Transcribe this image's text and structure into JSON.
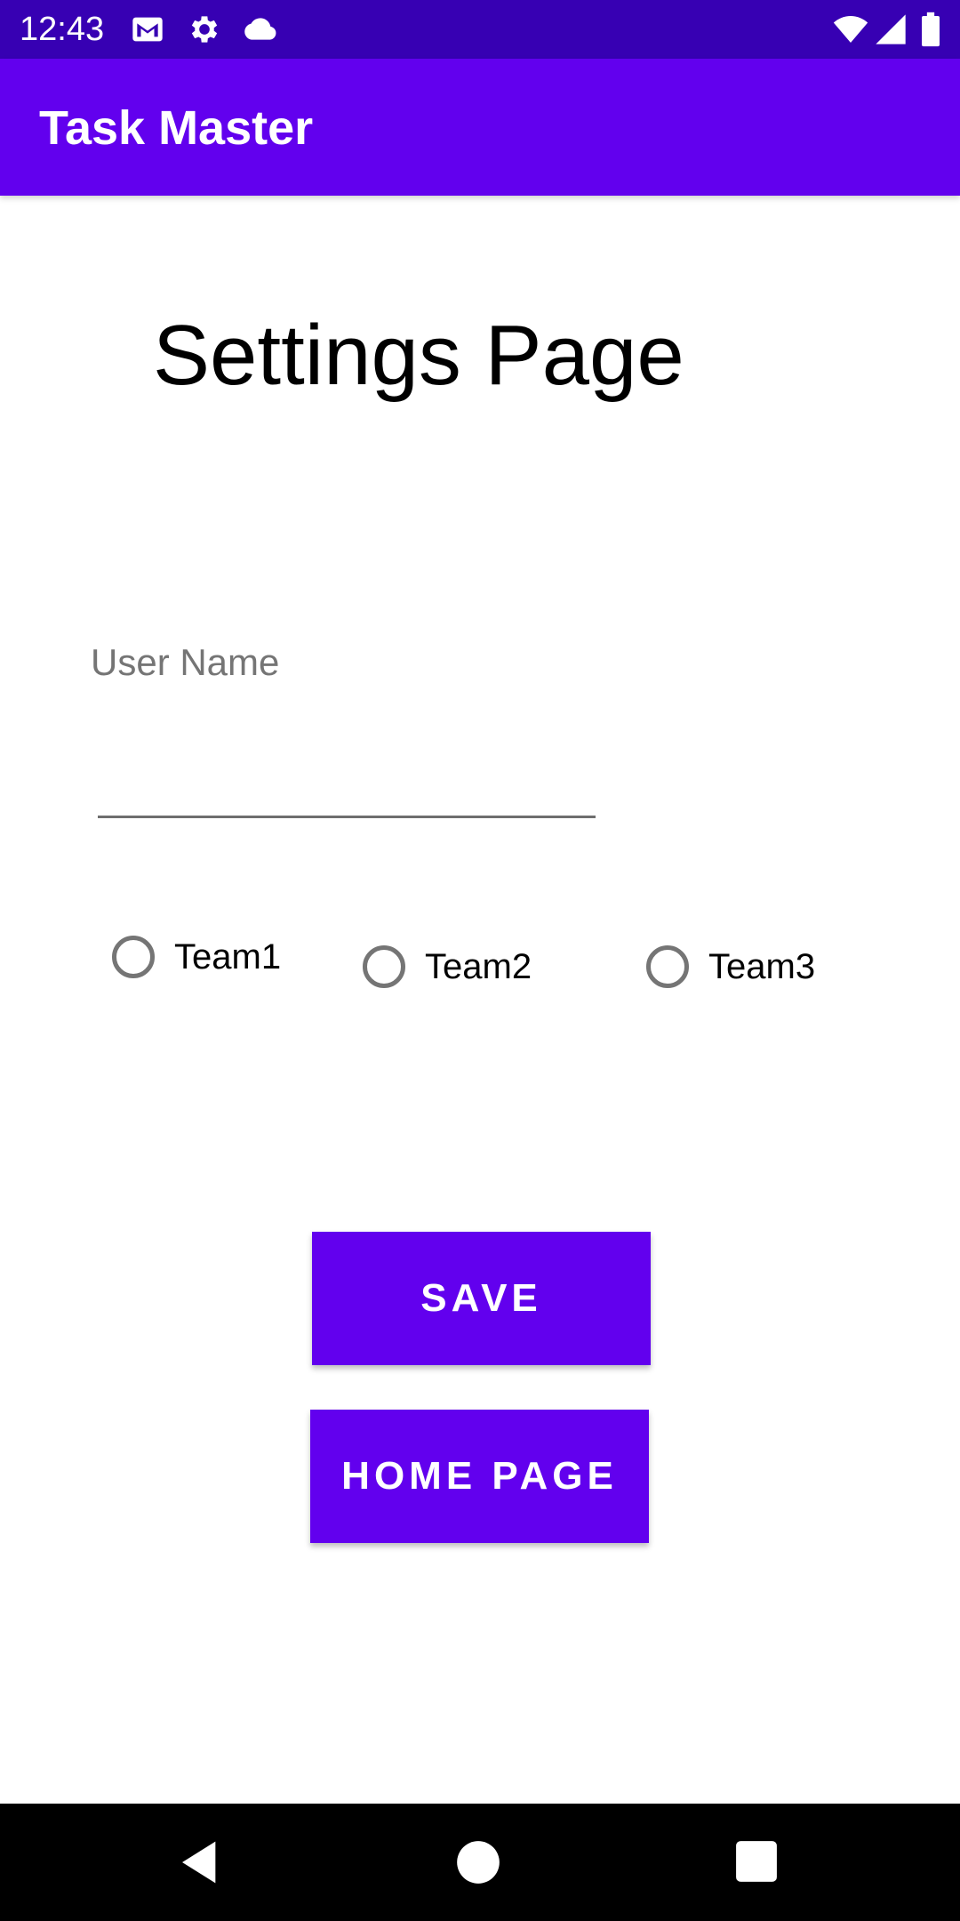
{
  "status_bar": {
    "time": "12:43",
    "left_icons": [
      "gmail-icon",
      "gear-icon",
      "cloud-icon"
    ],
    "right_icons": [
      "wifi-icon",
      "signal-icon",
      "battery-icon"
    ]
  },
  "app_bar": {
    "title": "Task Master"
  },
  "page": {
    "title": "Settings Page"
  },
  "form": {
    "username_label": "User Name",
    "username_value": "",
    "teams": [
      {
        "label": "Team1",
        "selected": false
      },
      {
        "label": "Team2",
        "selected": false
      },
      {
        "label": "Team3",
        "selected": false
      }
    ]
  },
  "buttons": {
    "save_label": "SAVE",
    "home_label": "HOME PAGE"
  },
  "nav_bar": {
    "icons": [
      "back-icon",
      "home-icon",
      "recents-icon"
    ]
  },
  "colors": {
    "status_bar": "#3700B3",
    "primary": "#6200EE",
    "nav_bar": "#000000",
    "label_gray": "#757575"
  }
}
